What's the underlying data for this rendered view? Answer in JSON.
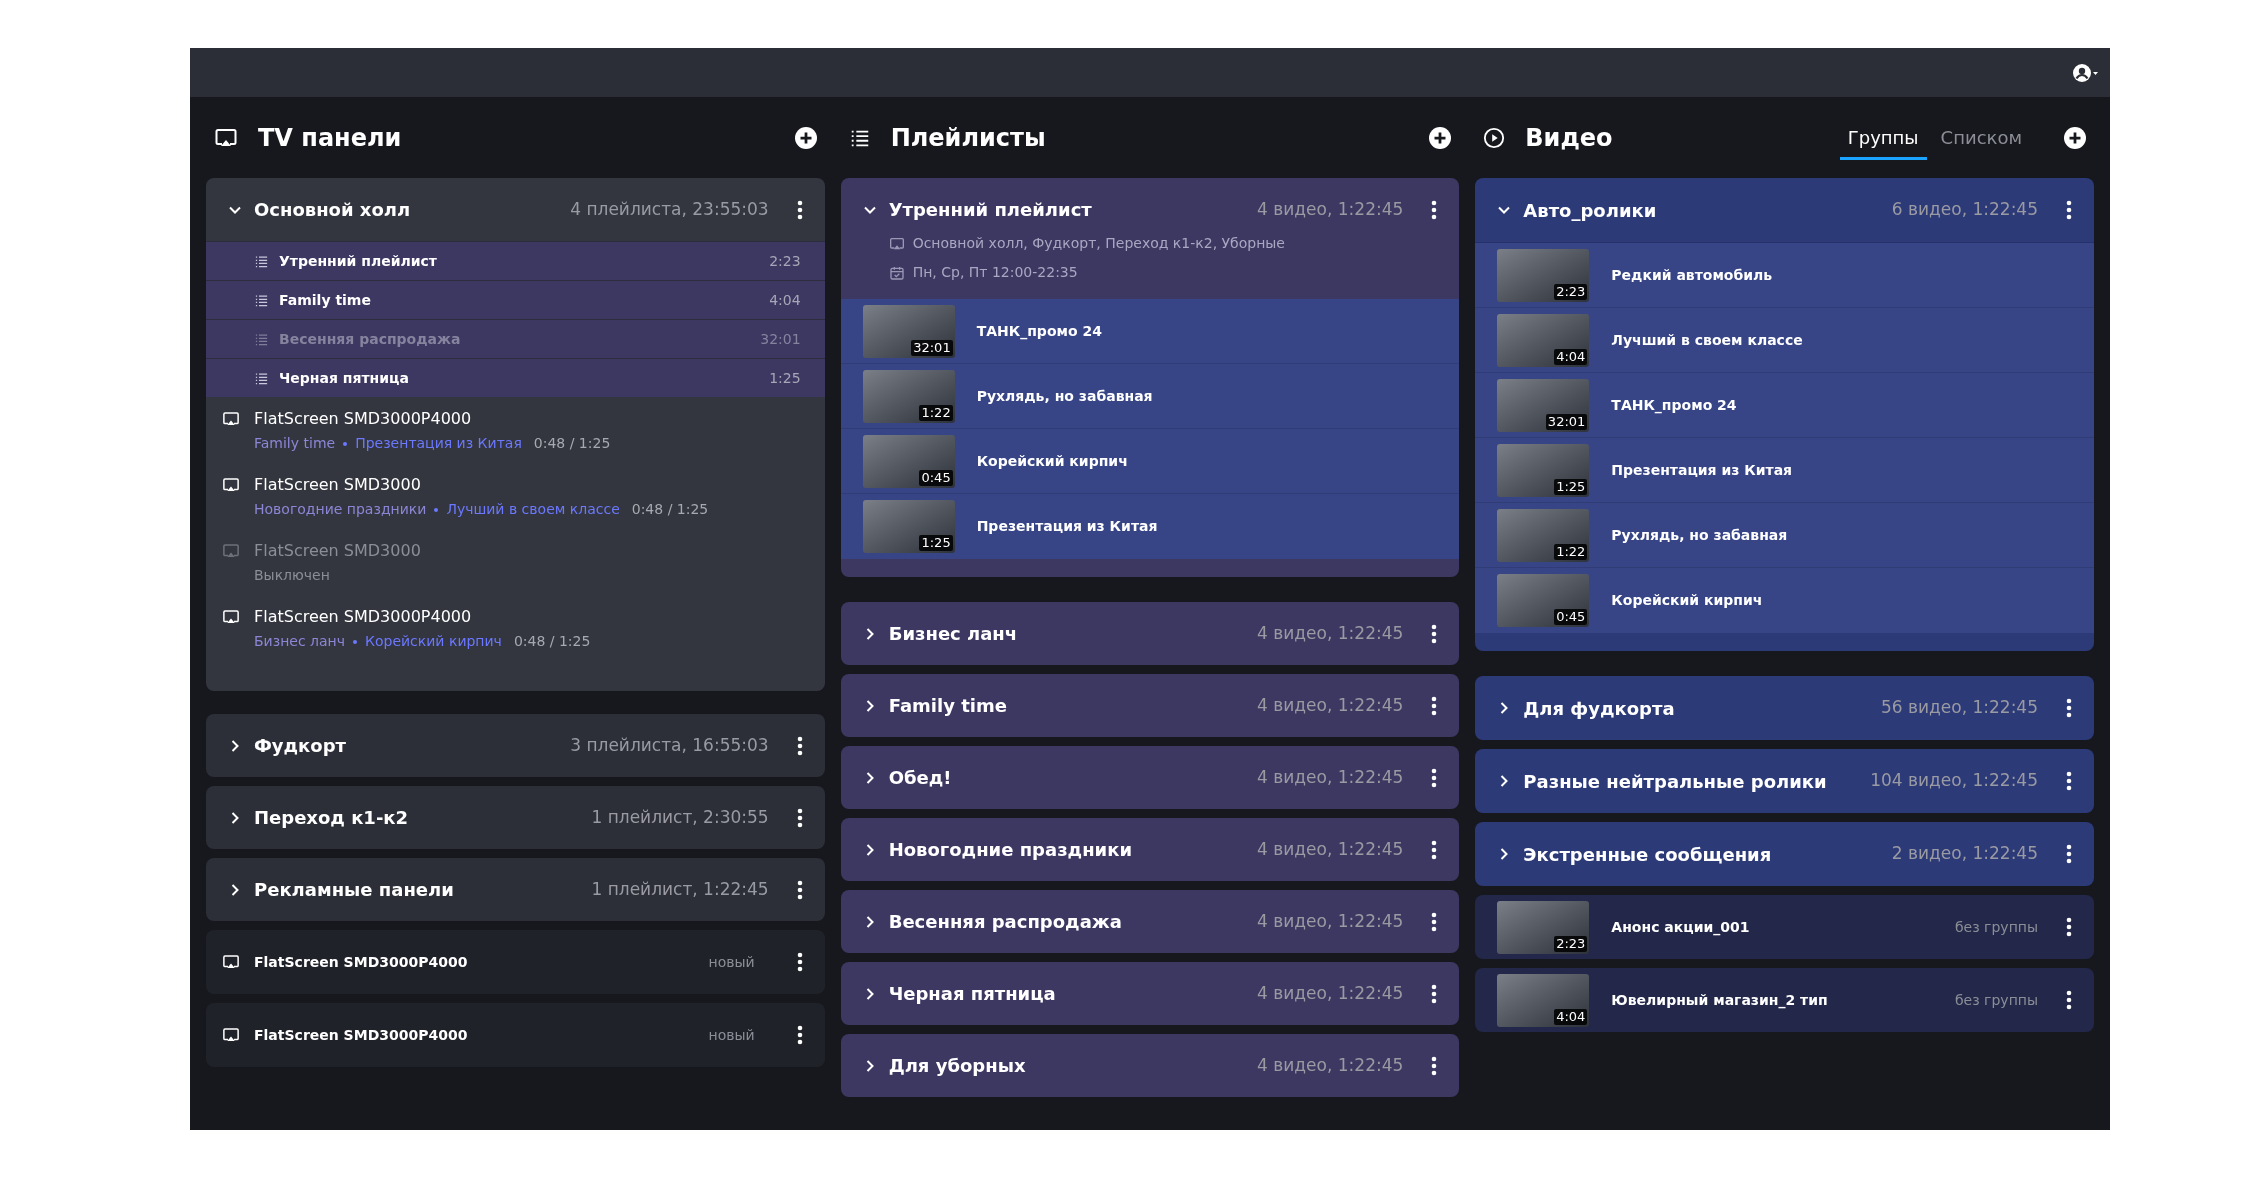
{
  "tv_panels": {
    "title": "TV панели",
    "items": [
      {
        "kind": "group",
        "name": "Основной холл",
        "summary": "4 плейлиста, 23:55:03",
        "expanded": true,
        "playlists": [
          {
            "name": "Утренний плейлист",
            "duration": "2:23",
            "disabled": false
          },
          {
            "name": "Family time",
            "duration": "4:04",
            "disabled": false
          },
          {
            "name": "Весенняя распродажа",
            "duration": "32:01",
            "disabled": true
          },
          {
            "name": "Черная пятница",
            "duration": "1:25",
            "disabled": false
          }
        ],
        "devices": [
          {
            "name": "FlatScreen SMD3000P4000",
            "off": false,
            "playlist": "Family time",
            "video": "Презентация из Китая",
            "time": "0:48 / 1:25"
          },
          {
            "name": "FlatScreen SMD3000",
            "off": false,
            "playlist": "Новогодние праздники",
            "video": "Лучший в своем классе",
            "time": "0:48 / 1:25"
          },
          {
            "name": "FlatScreen SMD3000",
            "off": true,
            "status": "Выключен"
          },
          {
            "name": "FlatScreen SMD3000P4000",
            "off": false,
            "playlist": "Бизнес ланч",
            "video": "Корейский кирпич",
            "time": "0:48 / 1:25"
          }
        ]
      },
      {
        "kind": "group",
        "name": "Фудкорт",
        "summary": "3 плейлиста, 16:55:03",
        "expanded": false
      },
      {
        "kind": "group",
        "name": "Переход к1-к2",
        "summary": "1 плейлист, 2:30:55",
        "expanded": false
      },
      {
        "kind": "group",
        "name": "Рекламные панели",
        "summary": "1 плейлист, 1:22:45",
        "expanded": false
      },
      {
        "kind": "device",
        "name": "FlatScreen SMD3000P4000",
        "status": "новый"
      },
      {
        "kind": "device",
        "name": "FlatScreen SMD3000P4000",
        "status": "новый"
      }
    ]
  },
  "playlists": {
    "title": "Плейлисты",
    "items": [
      {
        "name": "Утренний плейлист",
        "summary": "4 видео, 1:22:45",
        "expanded": true,
        "screens": "Основной холл, Фудкорт, Переход к1-к2, Уборные",
        "schedule": "Пн, Ср, Пт 12:00-22:35",
        "videos": [
          {
            "name": "ТАНК_промо 24",
            "duration": "32:01"
          },
          {
            "name": "Рухлядь, но забавная",
            "duration": "1:22"
          },
          {
            "name": "Корейский кирпич",
            "duration": "0:45"
          },
          {
            "name": "Презентация из Китая",
            "duration": "1:25"
          }
        ]
      },
      {
        "name": "Бизнес ланч",
        "summary": "4 видео, 1:22:45",
        "expanded": false
      },
      {
        "name": "Family time",
        "summary": "4 видео, 1:22:45",
        "expanded": false
      },
      {
        "name": "Обед!",
        "summary": "4 видео, 1:22:45",
        "expanded": false
      },
      {
        "name": "Новогодние праздники",
        "summary": "4 видео, 1:22:45",
        "expanded": false
      },
      {
        "name": "Весенняя распродажа",
        "summary": "4 видео, 1:22:45",
        "expanded": false
      },
      {
        "name": "Черная пятница",
        "summary": "4 видео, 1:22:45",
        "expanded": false
      },
      {
        "name": "Для уборных",
        "summary": "4 видео, 1:22:45",
        "expanded": false
      }
    ]
  },
  "videos": {
    "title": "Видео",
    "tabs": [
      {
        "label": "Группы",
        "selected": true
      },
      {
        "label": "Списком",
        "selected": false
      }
    ],
    "items": [
      {
        "kind": "group",
        "name": "Авто_ролики",
        "summary": "6 видео, 1:22:45",
        "expanded": true,
        "videos": [
          {
            "name": "Редкий автомобиль",
            "duration": "2:23"
          },
          {
            "name": "Лучший в своем классе",
            "duration": "4:04"
          },
          {
            "name": "ТАНК_промо 24",
            "duration": "32:01"
          },
          {
            "name": "Презентация из Китая",
            "duration": "1:25"
          },
          {
            "name": "Рухлядь, но забавная",
            "duration": "1:22"
          },
          {
            "name": "Корейский кирпич",
            "duration": "0:45"
          }
        ]
      },
      {
        "kind": "group",
        "name": "Для фудкорта",
        "summary": "56 видео, 1:22:45",
        "expanded": false
      },
      {
        "kind": "group",
        "name": "Разные нейтральные ролики",
        "summary": "104 видео, 1:22:45",
        "expanded": false
      },
      {
        "kind": "group",
        "name": "Экстренные сообщения",
        "summary": "2 видео, 1:22:45",
        "expanded": false
      },
      {
        "kind": "video",
        "name": "Анонс акции_001",
        "duration": "2:23",
        "status": "без группы"
      },
      {
        "kind": "video",
        "name": "Ювелирный магазин_2 тип",
        "duration": "4:04",
        "status": "без группы"
      }
    ]
  }
}
